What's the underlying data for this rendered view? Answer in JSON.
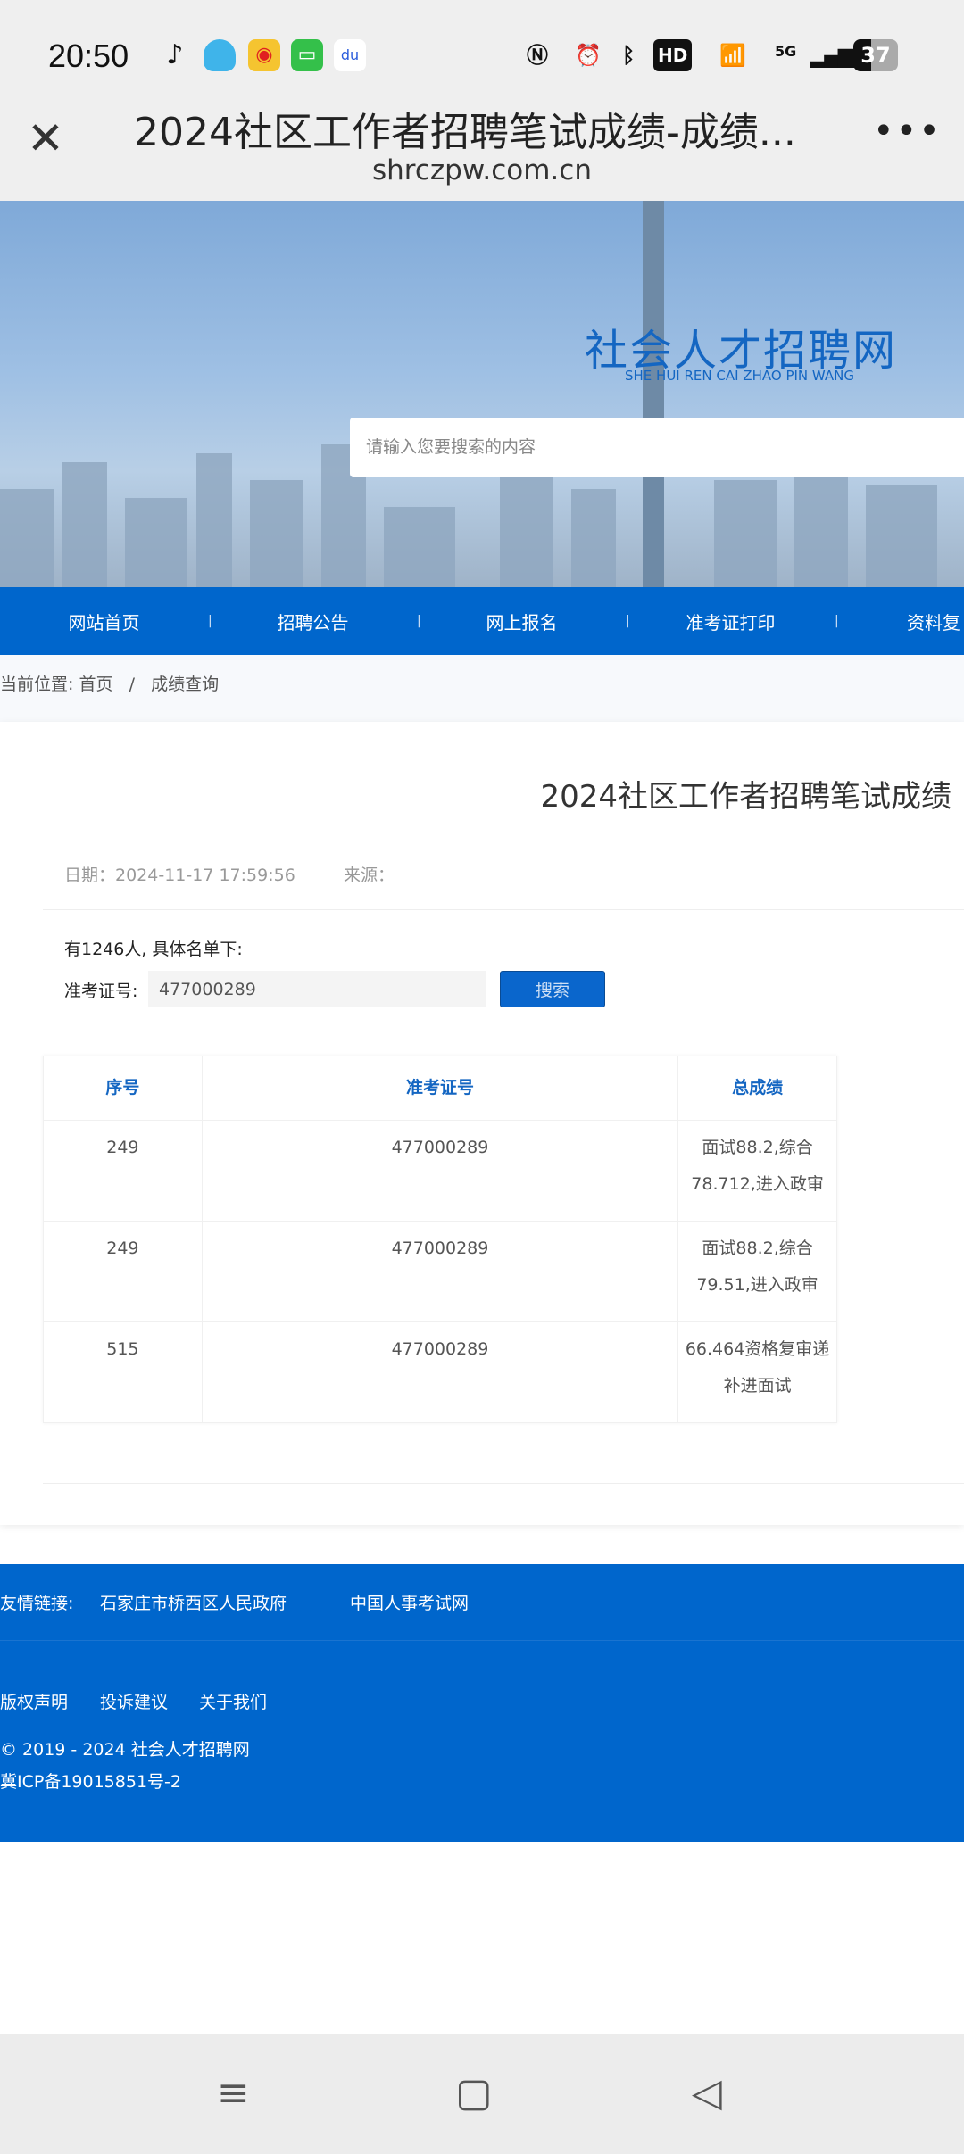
{
  "status_bar": {
    "time": "20:50",
    "battery": "37",
    "network": "5G",
    "hd": "HD"
  },
  "browser": {
    "title": "2024社区工作者招聘笔试成绩-成绩...",
    "url": "shrczpw.com.cn",
    "close_icon": "close-icon",
    "more_icon": "more-icon"
  },
  "banner": {
    "logo": "社会人才招聘网",
    "logo_sub": "SHE HUI REN CAI ZHAO PIN WANG",
    "search_placeholder": "请输入您要搜索的内容"
  },
  "nav": [
    "网站首页",
    "招聘公告",
    "网上报名",
    "准考证打印",
    "资料复"
  ],
  "breadcrumb": {
    "prefix": "当前位置:",
    "home": "首页",
    "sep": "/",
    "current": "成绩查询"
  },
  "article": {
    "title": "2024社区工作者招聘笔试成绩",
    "date": "日期：2024-11-17 17:59:56",
    "source": "来源：",
    "count": "有1246人, 具体名单下:",
    "query_label": "准考证号:",
    "query_value": "477000289",
    "search_button": "搜索"
  },
  "table": {
    "headers": [
      "序号",
      "准考证号",
      "总成绩"
    ],
    "rows": [
      {
        "no": "249",
        "id": "477000289",
        "score": "面试88.2,综合78.712,进入政审"
      },
      {
        "no": "249",
        "id": "477000289",
        "score": "面试88.2,综合79.51,进入政审"
      },
      {
        "no": "515",
        "id": "477000289",
        "score": "66.464资格复审递补进面试"
      }
    ]
  },
  "footer": {
    "links_label": "友情链接:",
    "links": [
      "石家庄市桥西区人民政府",
      "中国人事考试网"
    ],
    "bottom_links": [
      "版权声明",
      "投诉建议",
      "关于我们"
    ],
    "copyright": "© 2019 - 2024 社会人才招聘网",
    "icp": "冀ICP备19015851号-2"
  },
  "system_nav": {
    "menu": "≡",
    "home": "▢",
    "back": "◁"
  }
}
